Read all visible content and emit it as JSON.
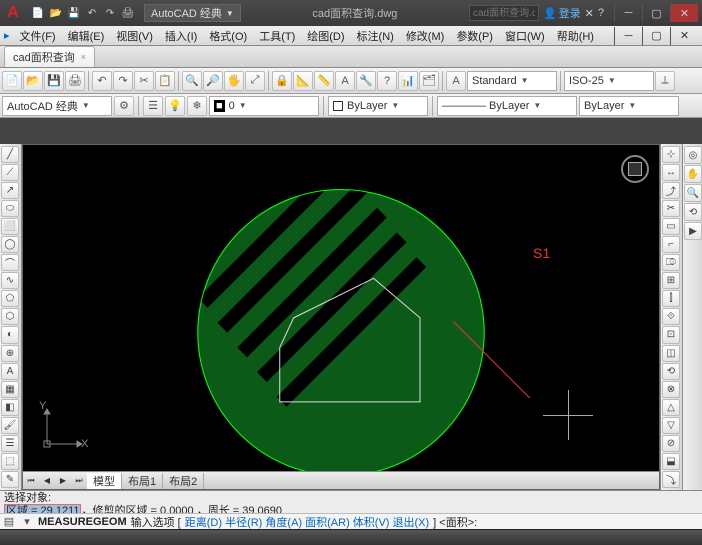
{
  "title": {
    "workspace_label": "AutoCAD 经典",
    "document": "cad面积查询.dwg",
    "login": "登录"
  },
  "menu": [
    "文件(F)",
    "编辑(E)",
    "视图(V)",
    "插入(I)",
    "格式(O)",
    "工具(T)",
    "绘图(D)",
    "标注(N)",
    "修改(M)",
    "参数(P)",
    "窗口(W)",
    "帮助(H)"
  ],
  "doctab": {
    "name": "cad面积查询",
    "close": "×"
  },
  "toolbar1_icons": [
    "📄",
    "📂",
    "💾",
    "🖨",
    "↶",
    "↷",
    "✂",
    "📋",
    "🔍",
    "🔎",
    "🖐",
    "⤢",
    "🔒",
    "📐",
    "📏",
    "A",
    "🔧",
    "?",
    "📊",
    "🗂"
  ],
  "style_combo": {
    "standard": "Standard",
    "iso": "ISO-25"
  },
  "propbar": {
    "workspace": "AutoCAD 经典",
    "layer_color": "■",
    "layer_name": "0",
    "bylayer": "ByLayer",
    "line": "———— ByLayer"
  },
  "draw_palette": [
    "╱",
    "⟋",
    "↗",
    "⬭",
    "⬜",
    "◯",
    "⌒",
    "∿",
    "⬠",
    "⬡",
    "◐",
    "⊕",
    "A",
    "▦",
    "◧",
    "🖌",
    "☰",
    "⬚",
    "✎",
    "□"
  ],
  "modify_palette": [
    "⊹",
    "↔",
    "⤴",
    "✂",
    "▭",
    "⌐",
    "⎄",
    "⊞",
    "⫿",
    "⟐",
    "⊡",
    "◫",
    "⟲",
    "⊗",
    "△",
    "▽",
    "⊘",
    "⬓",
    "⤵",
    "✕"
  ],
  "layout": {
    "nav": [
      "⏮",
      "◀",
      "▶",
      "⏭"
    ],
    "tabs": [
      "模型",
      "布局1",
      "布局2"
    ]
  },
  "canvas": {
    "annotation": "S1",
    "ucs_x": "X",
    "ucs_y": "Y"
  },
  "cmd": {
    "line1": "选择对象:",
    "area_label": "区域 = 29.1211",
    "line2_rest": "，修剪的区域 = 0.0000 ，周长 = 39.0690",
    "prompt_cmd": "MEASUREGEOM",
    "prompt_text": " 输入选项 [",
    "opts": "距离(D) 半径(R) 角度(A) 面积(AR) 体积(V) 退出(X)",
    "prompt_tail": "] <面积>:"
  }
}
